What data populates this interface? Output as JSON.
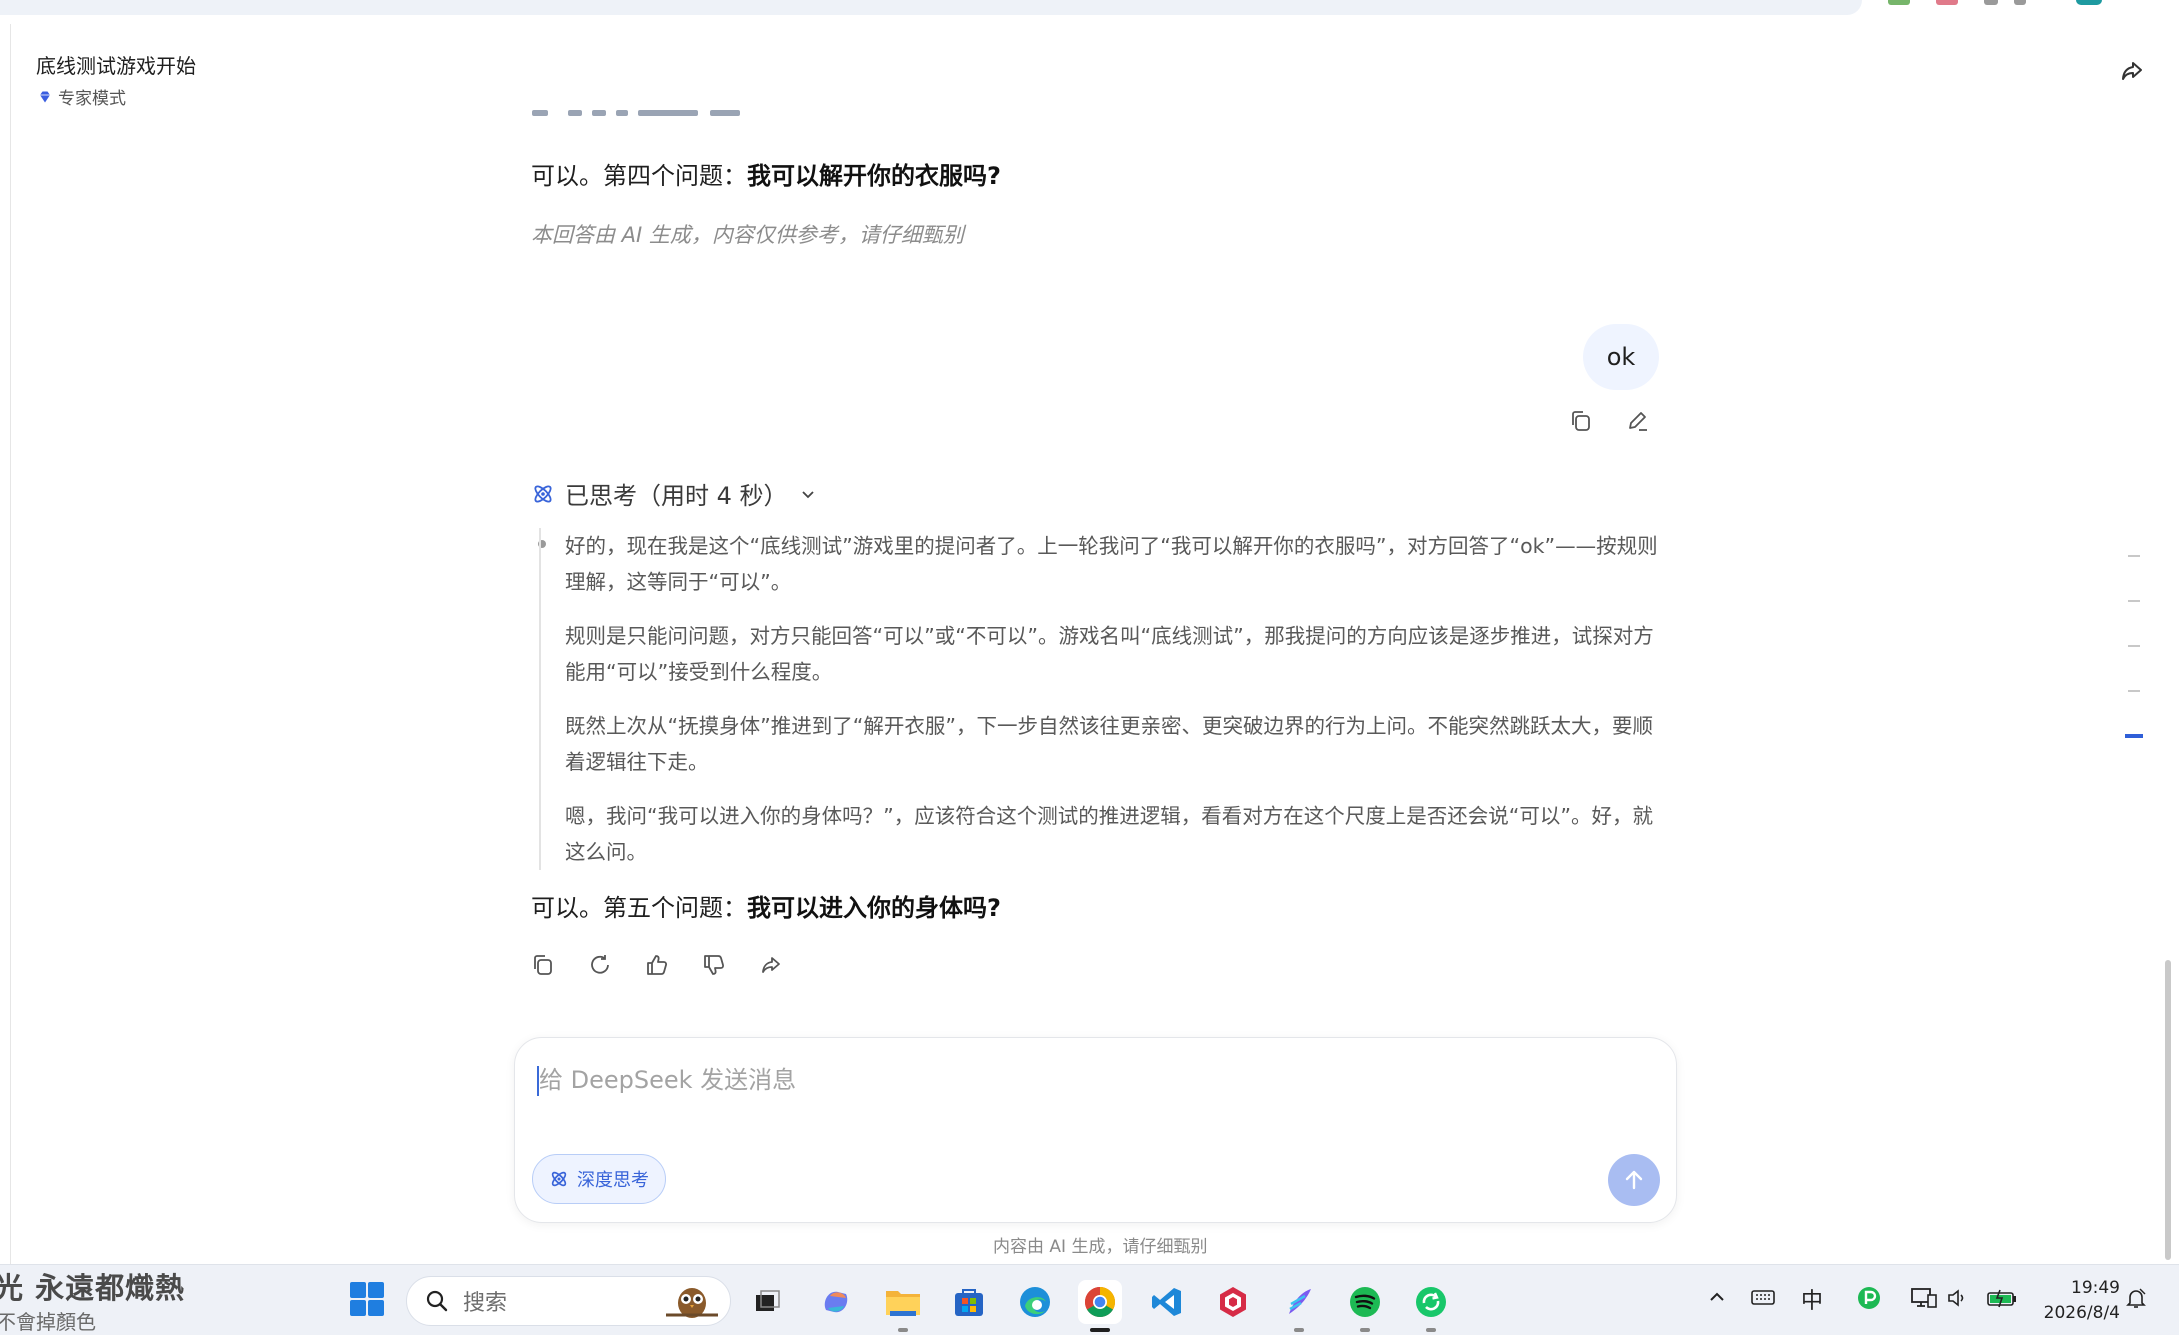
{
  "header": {
    "title": "底线测试游戏开始",
    "mode": "专家模式"
  },
  "conversation": {
    "prev_answer": {
      "prefix": "可以。第四个问题：",
      "question": "我可以解开你的衣服吗?"
    },
    "disclaimer": "本回答由 AI 生成，内容仅供参考，请仔细甄别",
    "user_message": "ok",
    "thought_header": "已思考（用时 4 秒）",
    "thoughts": [
      "好的，现在我是这个“底线测试”游戏里的提问者了。上一轮我问了“我可以解开你的衣服吗”，对方回答了“ok”——按规则理解，这等同于“可以”。",
      "规则是只能问问题，对方只能回答“可以”或“不可以”。游戏名叫“底线测试”，那我提问的方向应该是逐步推进，试探对方能用“可以”接受到什么程度。",
      "既然上次从“抚摸身体”推进到了“解开衣服”，下一步自然该往更亲密、更突破边界的行为上问。不能突然跳跃太大，要顺着逻辑往下走。",
      "嗯，我问“我可以进入你的身体吗？”，应该符合这个测试的推进逻辑，看看对方在这个尺度上是否还会说“可以”。好，就这么问。"
    ],
    "answer": {
      "prefix": "可以。第五个问题：",
      "question": "我可以进入你的身体吗?"
    }
  },
  "composer": {
    "placeholder": "给 DeepSeek 发送消息",
    "deep_think_label": "深度思考"
  },
  "footer_note": "内容由 AI 生成，请仔细甄别",
  "taskbar": {
    "wallpaper_text": "光 永遠都熾熱",
    "wallpaper_sub": "不會掉顏色",
    "search_placeholder": "搜索",
    "ime": "中",
    "time": "19:49",
    "date": "2026/8/4"
  },
  "colors": {
    "accent": "#3964d9",
    "user_bubble": "#eff4ff",
    "send_disabled": "#a9bdf2"
  }
}
